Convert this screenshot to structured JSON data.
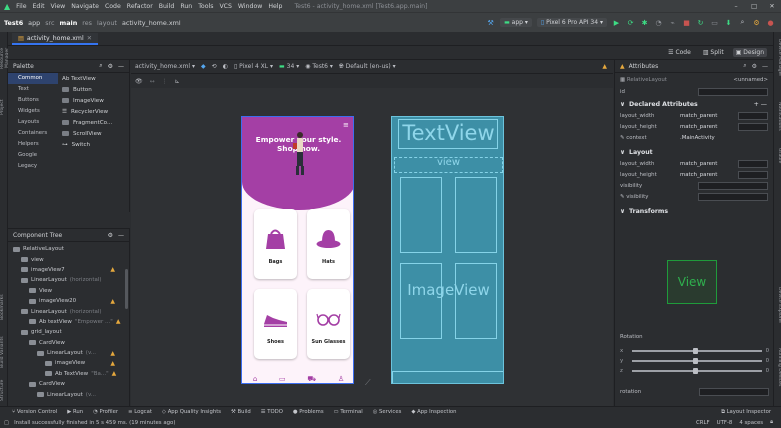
{
  "menu": [
    "File",
    "Edit",
    "View",
    "Navigate",
    "Code",
    "Refactor",
    "Build",
    "Run",
    "Tools",
    "VCS",
    "Window",
    "Help"
  ],
  "window_title": "Test6 - activity_home.xml [Test6.app.main]",
  "breadcrumb": [
    "Test6",
    "app",
    "src",
    "main",
    "res",
    "layout",
    "activity_home.xml"
  ],
  "run_config": "app",
  "device": "Pixel 6 Pro API 34",
  "file_tab": "activity_home.xml",
  "design_modes": [
    "Code",
    "Split",
    "Design"
  ],
  "palette": {
    "title": "Palette",
    "categories": [
      "Common",
      "Text",
      "Buttons",
      "Widgets",
      "Layouts",
      "Containers",
      "Helpers",
      "Google",
      "Legacy"
    ],
    "items": [
      "Ab TextView",
      "Button",
      "ImageView",
      "RecyclerView",
      "FragmentCo...",
      "ScrollView",
      "Switch"
    ]
  },
  "component_tree": {
    "title": "Component Tree",
    "nodes": [
      {
        "label": "RelativeLayout",
        "hint": "",
        "warn": false,
        "indent": 0
      },
      {
        "label": "view",
        "hint": "",
        "warn": false,
        "indent": 1
      },
      {
        "label": "imageView7",
        "hint": "",
        "warn": true,
        "indent": 1
      },
      {
        "label": "LinearLayout",
        "hint": "(horizontal)",
        "warn": false,
        "indent": 1
      },
      {
        "label": "View",
        "hint": "",
        "warn": false,
        "indent": 2
      },
      {
        "label": "imageView20",
        "hint": "",
        "warn": true,
        "indent": 2
      },
      {
        "label": "LinearLayout",
        "hint": "(horizontal)",
        "warn": false,
        "indent": 1
      },
      {
        "label": "Ab textView",
        "hint": "\"Empower ...\"",
        "warn": true,
        "indent": 2
      },
      {
        "label": "grid_layout",
        "hint": "",
        "warn": false,
        "indent": 1
      },
      {
        "label": "CardView",
        "hint": "",
        "warn": false,
        "indent": 2
      },
      {
        "label": "LinearLayout",
        "hint": "(v...",
        "warn": true,
        "indent": 3
      },
      {
        "label": "imageView",
        "hint": "",
        "warn": true,
        "indent": 4
      },
      {
        "label": "Ab TextView",
        "hint": "\"Ba...\"",
        "warn": true,
        "indent": 4
      },
      {
        "label": "CardView",
        "hint": "",
        "warn": false,
        "indent": 2
      },
      {
        "label": "LinearLayout",
        "hint": "(v...",
        "warn": false,
        "indent": 3
      }
    ]
  },
  "canvas_toolbar": {
    "file": "activity_home.xml",
    "device": "Pixel 4 XL",
    "api": "34",
    "theme": "Test6",
    "locale": "Default (en-us)"
  },
  "phone": {
    "headline": "Empower your style.",
    "subline": "Shop now.",
    "cards": [
      "Bags",
      "Hats",
      "Shoes",
      "Sun Glasses"
    ]
  },
  "blueprint": {
    "textview": "TextView",
    "view": "view",
    "imageview": "ImageView"
  },
  "attributes": {
    "title": "Attributes",
    "component": "RelativeLayout",
    "name": "<unnamed>",
    "id_label": "id",
    "declared_title": "Declared Attributes",
    "declared": [
      {
        "k": "layout_width",
        "v": "match_parent"
      },
      {
        "k": "layout_height",
        "v": "match_parent"
      },
      {
        "k": "context",
        "v": ".MainActivity"
      }
    ],
    "layout_title": "Layout",
    "layout": [
      {
        "k": "layout_width",
        "v": "match_parent"
      },
      {
        "k": "layout_height",
        "v": "match_parent"
      },
      {
        "k": "visibility",
        "v": ""
      },
      {
        "k": "visibility",
        "v": ""
      }
    ],
    "transforms_title": "Transforms",
    "preview": "View",
    "rotation_label": "Rotation",
    "axes": [
      "x",
      "y",
      "z"
    ],
    "axis_value": "0",
    "rotation_field": "rotation"
  },
  "toolwindows": [
    "Version Control",
    "Run",
    "Profiler",
    "Logcat",
    "App Quality Insights",
    "Build",
    "TODO",
    "Problems",
    "Terminal",
    "Services",
    "App Inspection"
  ],
  "layout_inspector": "Layout Inspector",
  "status": {
    "message": "Install successfully finished in 5 s 459 ms. (19 minutes ago)",
    "line_sep": "CRLF",
    "encoding": "UTF-8",
    "indent": "4 spaces"
  },
  "colors": {
    "accent": "#3574f0",
    "brand": "#a43fa5",
    "warning": "#e5a83d",
    "blueprint": "#3d8fa6"
  }
}
